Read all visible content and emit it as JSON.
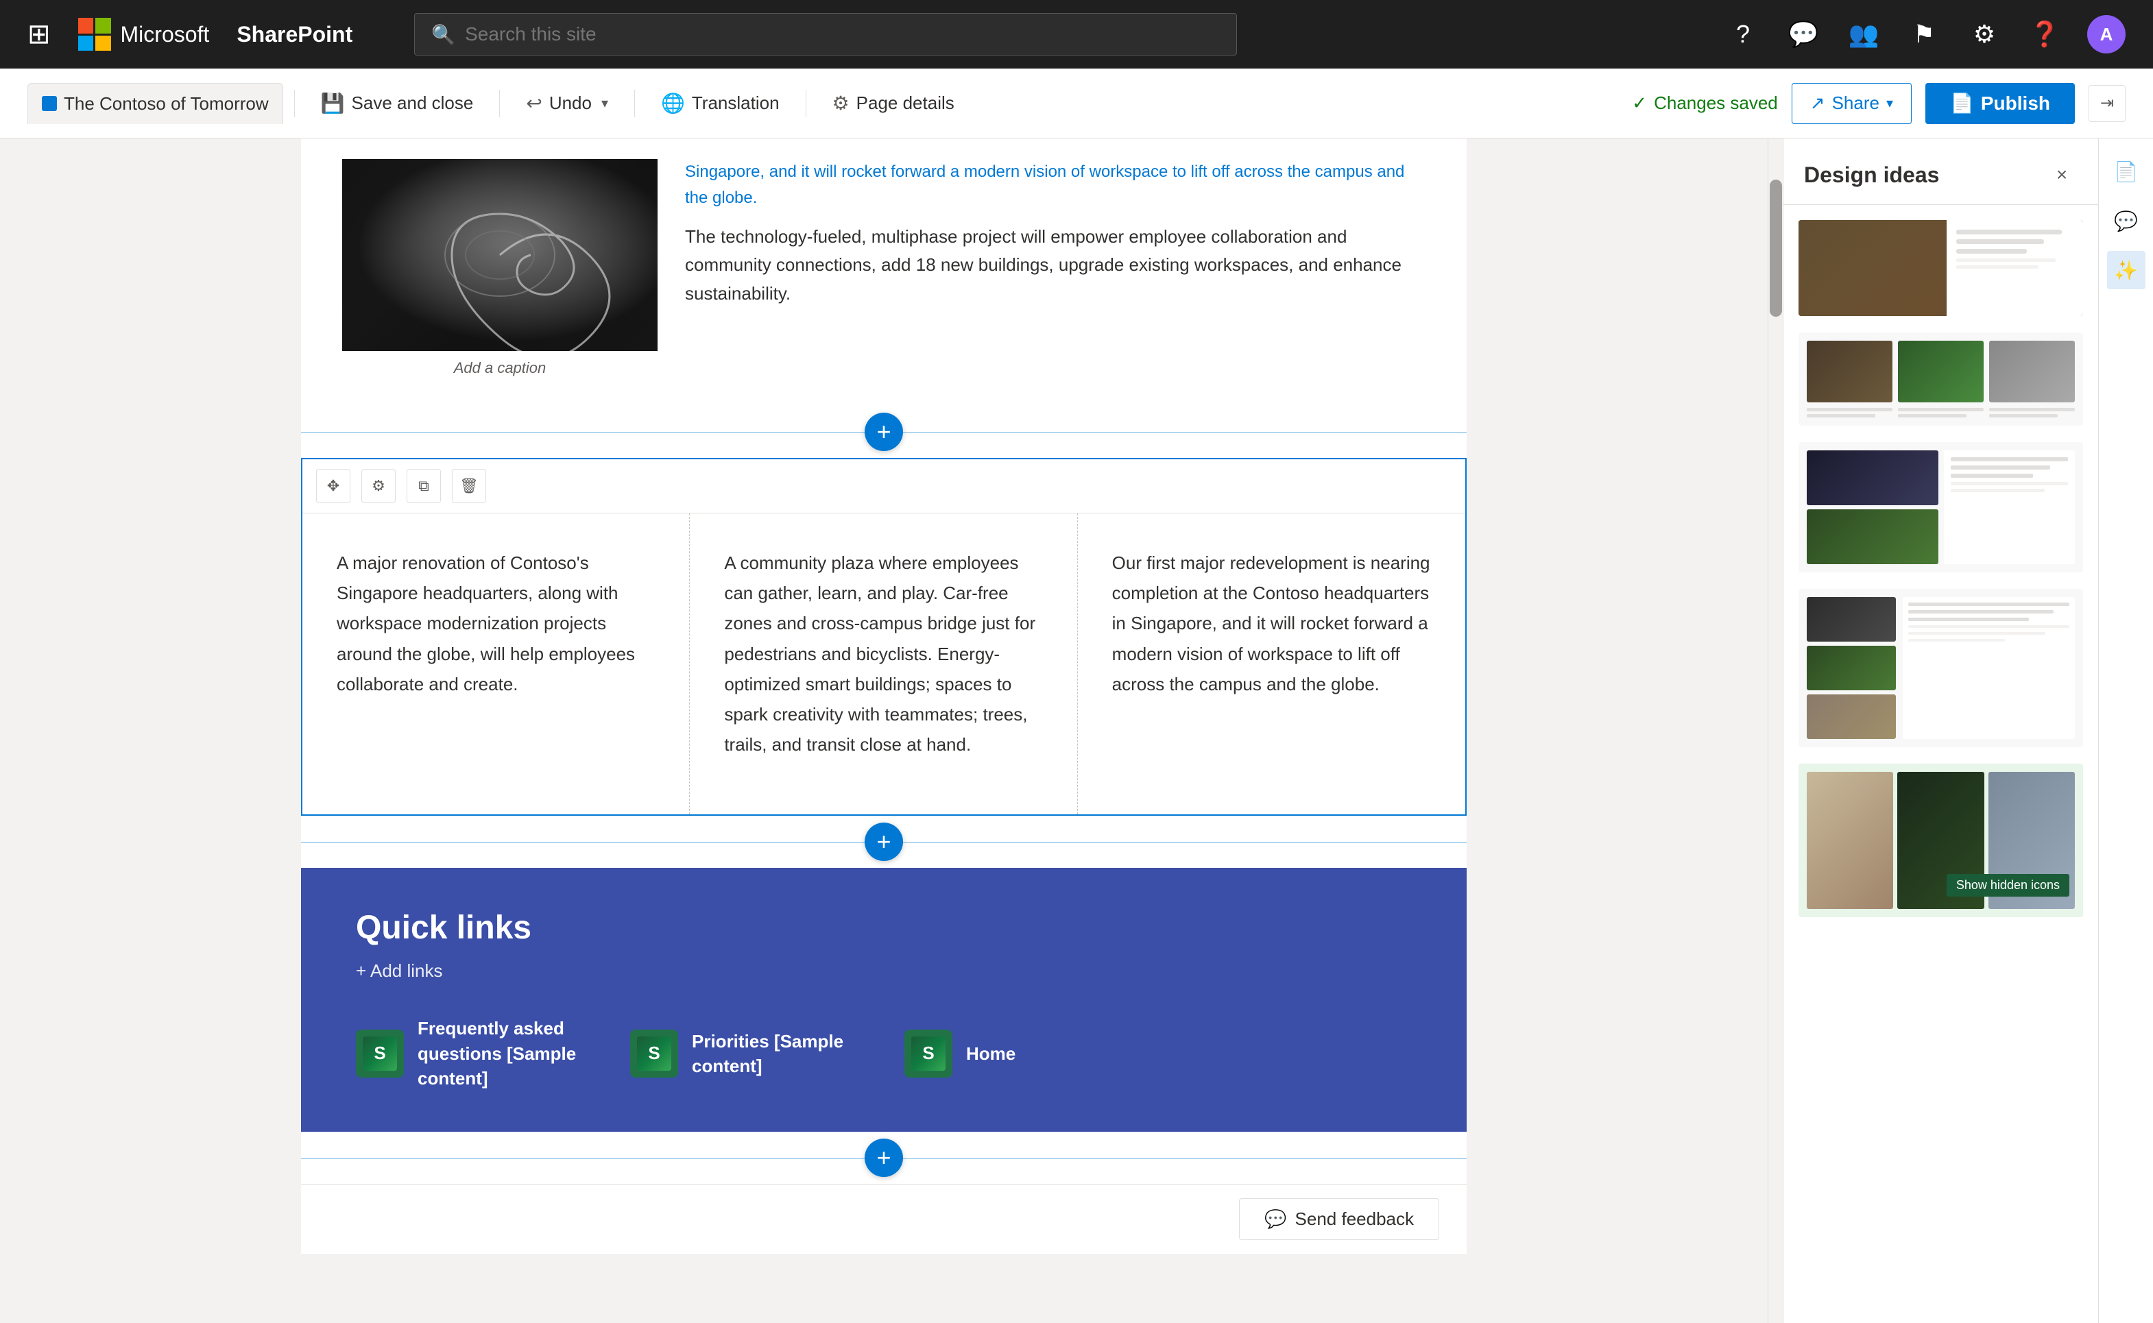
{
  "topnav": {
    "app_name": "Microsoft",
    "product": "SharePoint",
    "search_placeholder": "Search this site",
    "grid_icon": "⊞",
    "icons": [
      "?",
      "💬",
      "👥",
      "⚑",
      "⚙",
      "?"
    ]
  },
  "toolbar": {
    "site_tab_label": "The Contoso of Tomorrow",
    "save_close_label": "Save and close",
    "undo_label": "Undo",
    "translation_label": "Translation",
    "page_details_label": "Page details",
    "changes_saved_label": "Changes saved",
    "share_label": "Share",
    "publish_label": "Publish"
  },
  "design_ideas": {
    "title": "Design ideas",
    "close_btn": "×"
  },
  "page": {
    "intro_text": "The technology-fueled, multiphase project will empower employee collaboration and community connections, add 18 new buildings, upgrade existing workspaces, and enhance sustainability.",
    "image_caption": "Add a caption",
    "col1_text": "A major renovation of Contoso's Singapore headquarters, along with workspace modernization projects around the globe, will help employees collaborate and create.",
    "col2_text": "A community plaza where employees can gather, learn, and play. Car-free zones and cross-campus bridge just for pedestrians and bicyclists. Energy-optimized smart buildings; spaces to spark creativity with teammates; trees, trails, and transit close at hand.",
    "col3_text": "Our first major redevelopment is nearing completion at the Contoso headquarters in Singapore, and it will rocket forward a modern vision of workspace to lift off across the campus and the globe.",
    "quick_links_title": "Quick links",
    "add_links_label": "+ Add links",
    "links": [
      {
        "label": "Frequently asked questions [Sample content]"
      },
      {
        "label": "Priorities [Sample content]"
      },
      {
        "label": "Home"
      }
    ]
  },
  "feedback": {
    "button_label": "Send feedback"
  },
  "show_hidden": {
    "tooltip": "Show hidden icons"
  }
}
